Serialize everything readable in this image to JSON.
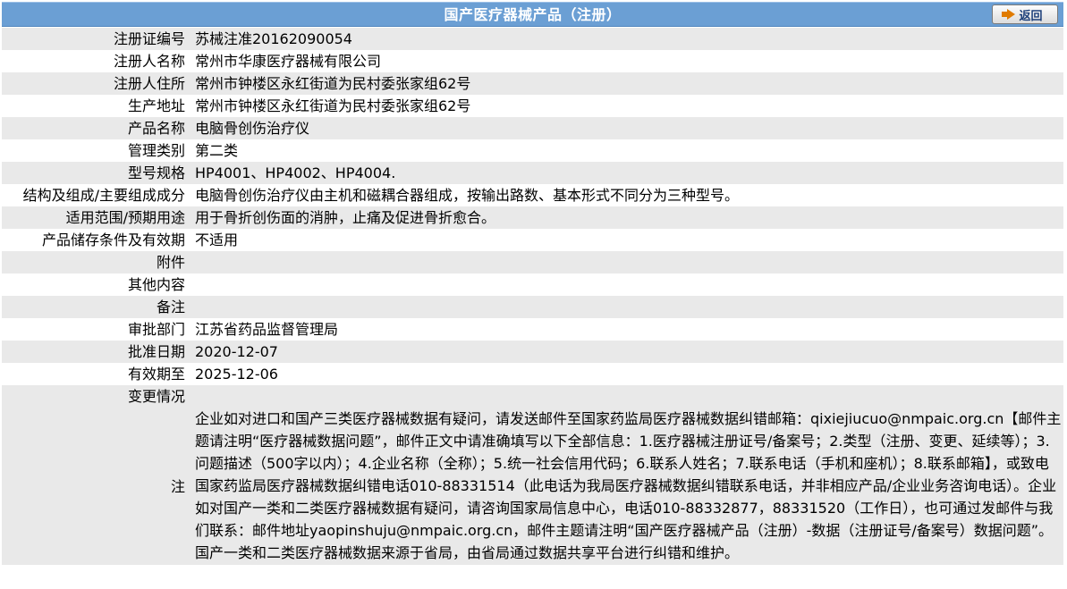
{
  "header": {
    "title": "国产医疗器械产品（注册）",
    "back_label": "返回",
    "bg_color": "#6b9fd4"
  },
  "rows": [
    {
      "label": "注册证编号",
      "value": "苏械注准20162090054"
    },
    {
      "label": "注册人名称",
      "value": "常州市华康医疗器械有限公司"
    },
    {
      "label": "注册人住所",
      "value": "常州市钟楼区永红街道为民村委张家组62号"
    },
    {
      "label": "生产地址",
      "value": "常州市钟楼区永红街道为民村委张家组62号"
    },
    {
      "label": "产品名称",
      "value": "电脑骨创伤治疗仪"
    },
    {
      "label": "管理类别",
      "value": "第二类"
    },
    {
      "label": "型号规格",
      "value": "HP4001、HP4002、HP4004."
    },
    {
      "label": "结构及组成/主要组成成分",
      "value": "电脑骨创伤治疗仪由主机和磁耦合器组成，按输出路数、基本形式不同分为三种型号。"
    },
    {
      "label": "适用范围/预期用途",
      "value": "用于骨折创伤面的消肿，止痛及促进骨折愈合。"
    },
    {
      "label": "产品储存条件及有效期",
      "value": "不适用"
    },
    {
      "label": "附件",
      "value": ""
    },
    {
      "label": "其他内容",
      "value": ""
    },
    {
      "label": "备注",
      "value": ""
    },
    {
      "label": "审批部门",
      "value": "江苏省药品监督管理局"
    },
    {
      "label": "批准日期",
      "value": "2020-12-07"
    },
    {
      "label": "有效期至",
      "value": "2025-12-06"
    },
    {
      "label": "变更情况",
      "value": ""
    }
  ],
  "note": {
    "label": "注",
    "text": "企业如对进口和国产三类医疗器械数据有疑问，请发送邮件至国家药监局医疗器械数据纠错邮箱：qixiejiucuo@nmpaic.org.cn【邮件主题请注明“医疗器械数据问题”，邮件正文中请准确填写以下全部信息：1.医疗器械注册证号/备案号；2.类型（注册、变更、延续等）；3.问题描述（500字以内）；4.企业名称（全称）；5.统一社会信用代码；6.联系人姓名；7.联系电话（手机和座机）；8.联系邮箱】，或致电国家药监局医疗器械数据纠错电话010-88331514（此电话为我局医疗器械数据纠错联系电话，并非相应产品/企业业务咨询电话）。企业如对国产一类和二类医疗器械数据有疑问，请咨询国家局信息中心，电话010-88332877，88331520（工作日），也可通过发邮件与我们联系：邮件地址yaopinshuju@nmpaic.org.cn，邮件主题请注明“国产医疗器械产品（注册）-数据（注册证号/备案号）数据问题”。国产一类和二类医疗器械数据来源于省局，由省局通过数据共享平台进行纠错和维护。"
  }
}
